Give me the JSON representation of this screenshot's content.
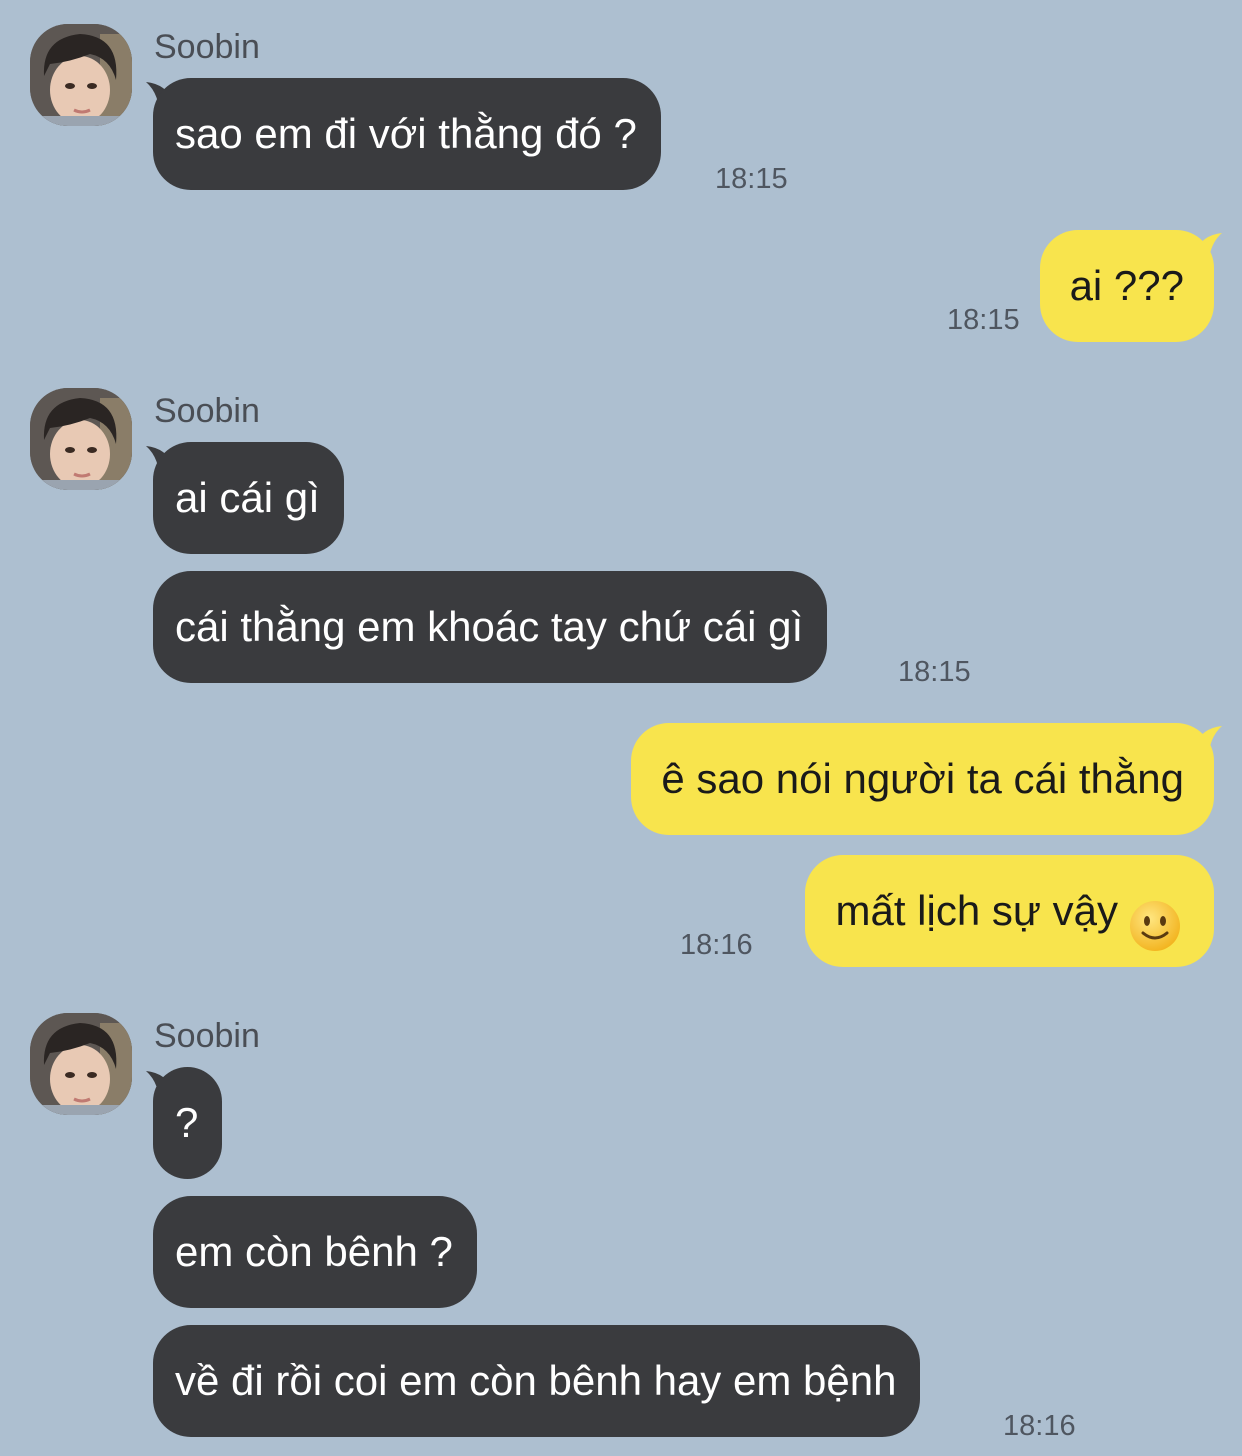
{
  "contact": {
    "name": "Soobin",
    "avatar_icon": "profile-photo"
  },
  "theme": {
    "background": "#adbfd0",
    "incoming_bubble": "#3a3b3e",
    "outgoing_bubble": "#f8e44d"
  },
  "messages": [
    {
      "dir": "in",
      "text": "sao em đi với thằng đó ?",
      "time": "18:15"
    },
    {
      "dir": "out",
      "text": "ai ???",
      "time": "18:15"
    },
    {
      "dir": "in",
      "text": "ai cái gì",
      "time": ""
    },
    {
      "dir": "in",
      "text": "cái thằng em khoác tay chứ cái gì",
      "time": "18:15"
    },
    {
      "dir": "out",
      "text": "ê sao nói người ta cái thằng",
      "time": ""
    },
    {
      "dir": "out",
      "text": "mất lịch sự vậy",
      "emoji": "slightly-smiling-face-icon",
      "time": "18:16"
    },
    {
      "dir": "in",
      "text": "?",
      "time": ""
    },
    {
      "dir": "in",
      "text": "em còn bênh ?",
      "time": ""
    },
    {
      "dir": "in",
      "text": "về đi rồi coi em còn bênh hay em bệnh",
      "time": "18:16"
    }
  ]
}
